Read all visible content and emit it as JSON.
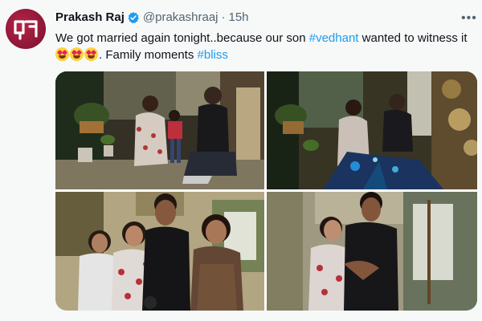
{
  "tweet": {
    "author_name": "Prakash Raj",
    "handle": "@prakashraaj",
    "separator": "·",
    "time": "15h",
    "more_label": "•••",
    "text_part1": "We got married again tonight..because our son ",
    "hashtag1": "#vedhant",
    "text_part2": " wanted to witness it ",
    "text_part3": ". Family moments ",
    "hashtag2": "#bliss",
    "emoji_count": 3
  },
  "colors": {
    "link": "#1d9bf0",
    "verified": "#1d9bf0",
    "muted": "#536471",
    "avatar": "#9d1b3f"
  },
  "media": {
    "photos": [
      {
        "label": "couple-seated-with-son"
      },
      {
        "label": "couple-under-lights"
      },
      {
        "label": "family-group-selfie"
      },
      {
        "label": "couple-embracing"
      }
    ]
  }
}
